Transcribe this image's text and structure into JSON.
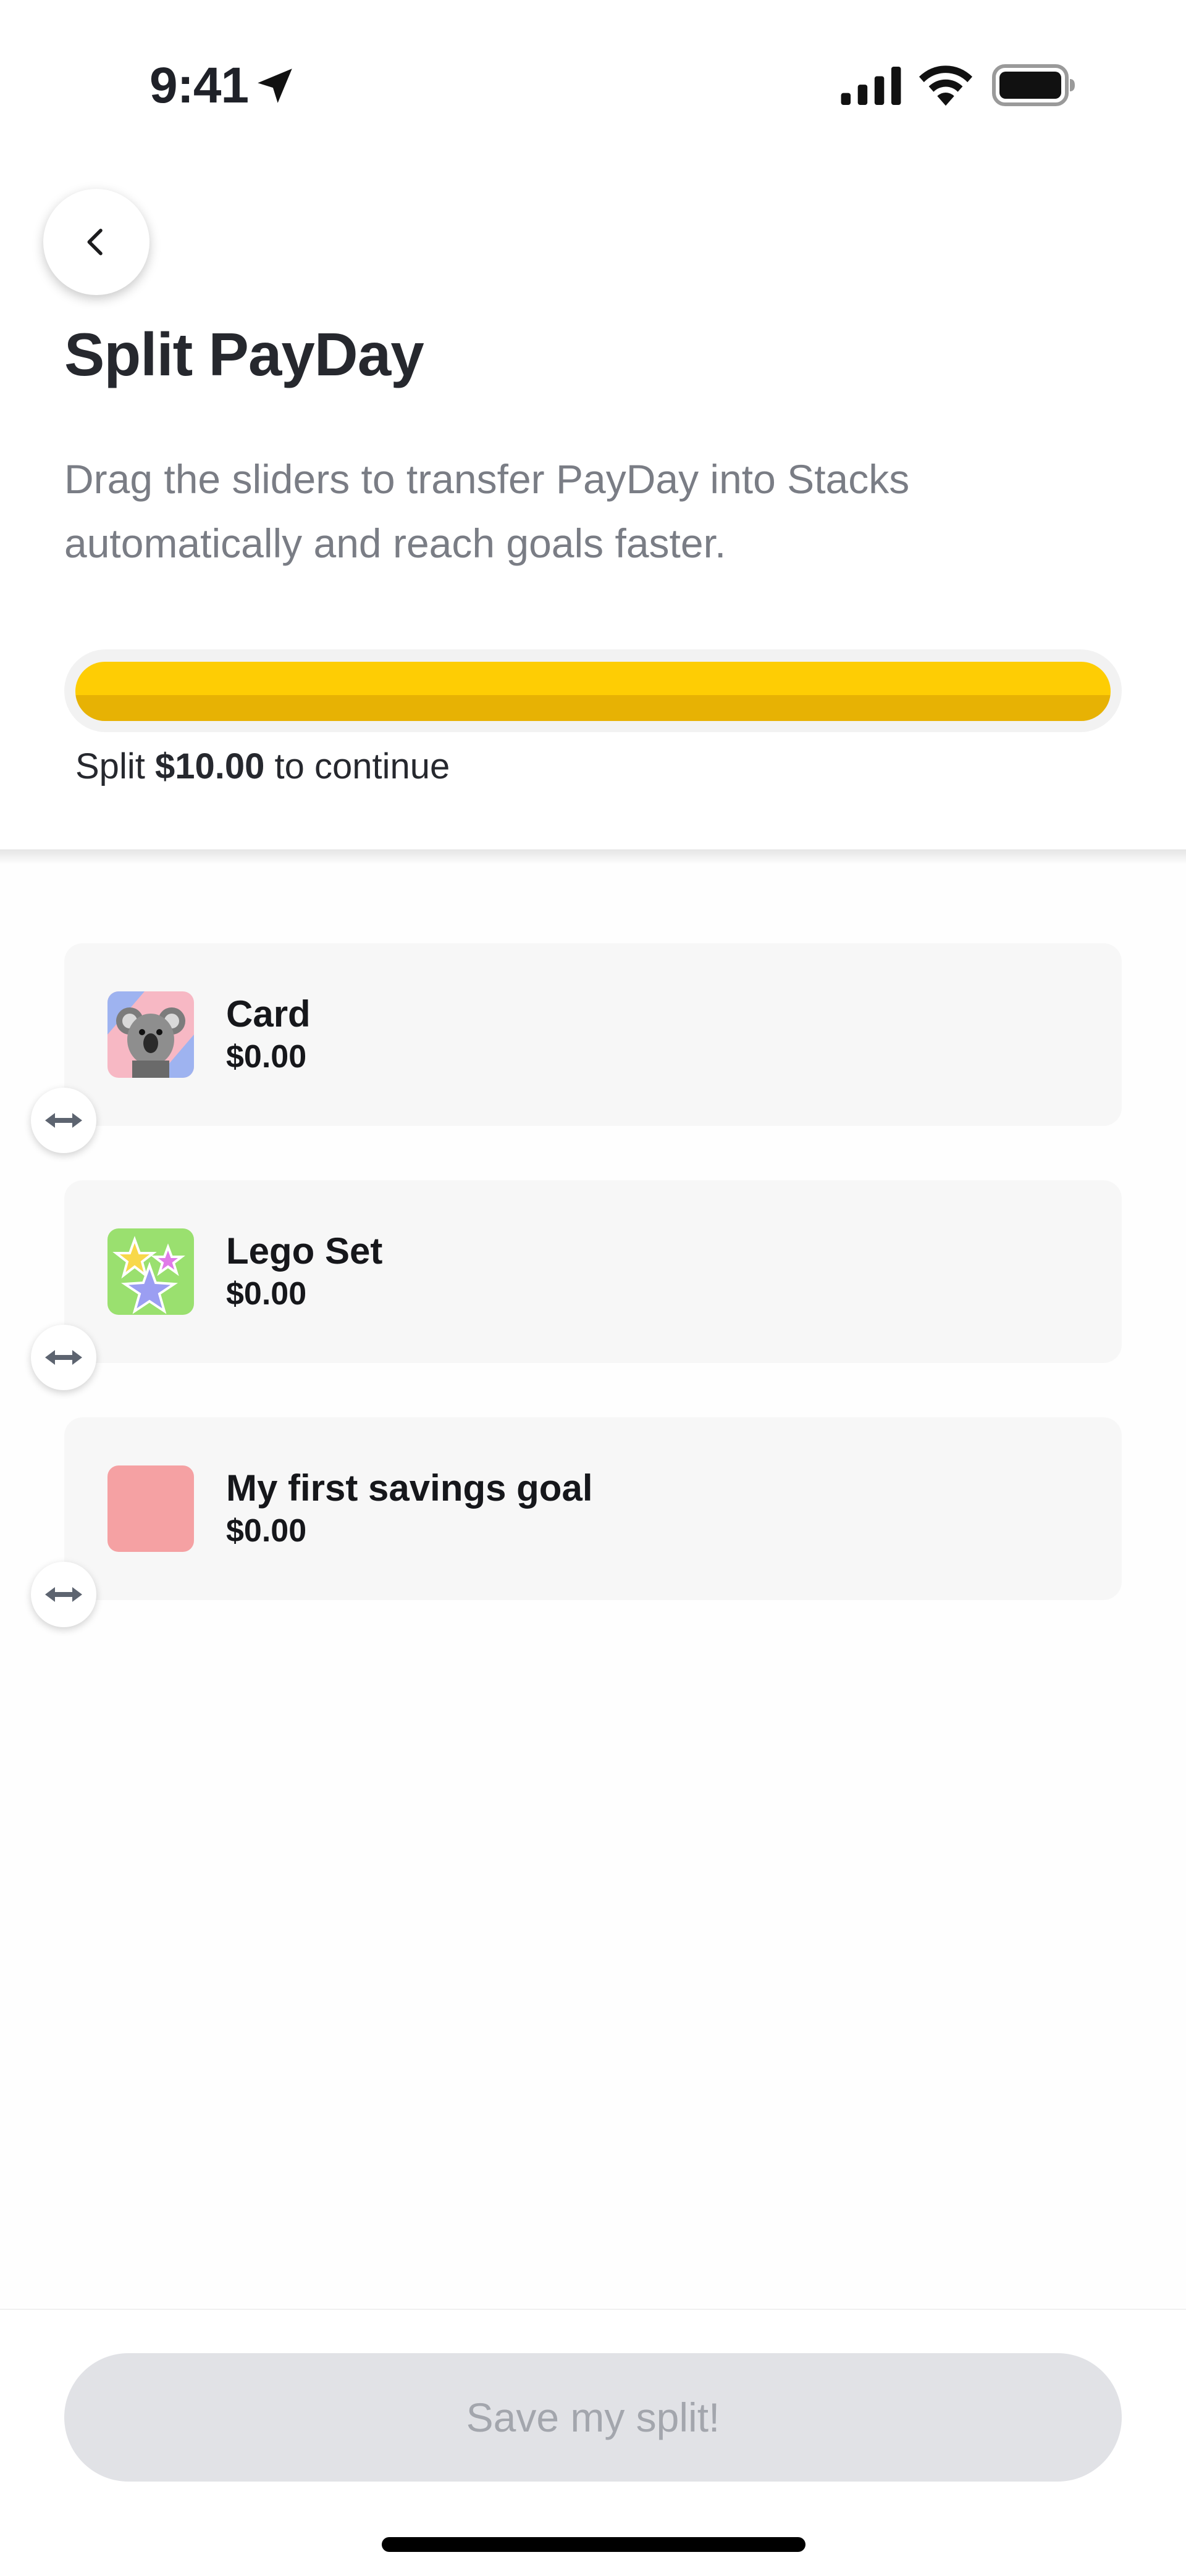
{
  "status_bar": {
    "time": "9:41"
  },
  "header": {
    "title": "Split PayDay",
    "subtitle": "Drag the sliders to transfer PayDay into Stacks automatically and reach goals faster."
  },
  "progress": {
    "fill_fraction": 1.0,
    "caption_prefix": "Split ",
    "caption_amount": "$10.00",
    "caption_suffix": " to continue",
    "fill_color": "#fecd04"
  },
  "stacks": [
    {
      "name": "Card",
      "amount": "$0.00",
      "icon": "koala-image"
    },
    {
      "name": "Lego Set",
      "amount": "$0.00",
      "icon": "stars-image"
    },
    {
      "name": "My first savings goal",
      "amount": "$0.00",
      "icon": "pink-swatch"
    }
  ],
  "footer": {
    "save_label": "Save my split!"
  },
  "colors": {
    "accent": "#fecd04",
    "disabled_button": "#e1e2e6",
    "card_bg": "#f7f7f7"
  }
}
